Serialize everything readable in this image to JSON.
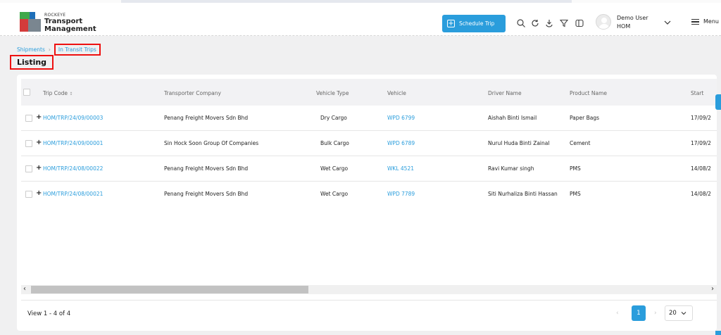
{
  "app": {
    "brand_small": "ROCKEYE",
    "brand_line1": "Transport",
    "brand_line2": "Management"
  },
  "header": {
    "schedule_label": "Schedule Trip",
    "user_name": "Demo User",
    "user_role": "HOM",
    "menu_label": "Menu",
    "icons": [
      "search-icon",
      "refresh-icon",
      "download-icon",
      "filter-icon",
      "layout-icon"
    ]
  },
  "breadcrumb": {
    "root": "Shipments",
    "current": "In Transit Trips"
  },
  "page": {
    "title": "Listing"
  },
  "table": {
    "columns": [
      "Trip Code",
      "Transporter Company",
      "Vehicle Type",
      "Vehicle",
      "Driver Name",
      "Product Name",
      "Start"
    ],
    "sort_indicator": "↕",
    "rows": [
      {
        "trip": "HOM/TRP/24/09/00003",
        "company": "Penang Freight Movers Sdn Bhd",
        "vtype": "Dry Cargo",
        "vehicle": "WPD 6799",
        "driver": "Aishah Binti Ismail",
        "product": "Paper Bags",
        "start": "17/09/2"
      },
      {
        "trip": "HOM/TRP/24/09/00001",
        "company": "Sin Hock Soon Group Of Companies",
        "vtype": "Bulk Cargo",
        "vehicle": "WPD 6789",
        "driver": "Nurul Huda Binti Zainal",
        "product": "Cement",
        "start": "17/09/2"
      },
      {
        "trip": "HOM/TRP/24/08/00022",
        "company": "Penang Freight Movers Sdn Bhd",
        "vtype": "Wet Cargo",
        "vehicle": "WKL 4521",
        "driver": "Ravi Kumar singh",
        "product": "PMS",
        "start": "14/08/2"
      },
      {
        "trip": "HOM/TRP/24/08/00021",
        "company": "Penang Freight Movers Sdn Bhd",
        "vtype": "Wet Cargo",
        "vehicle": "WPD 7789",
        "driver": "Siti Nurhaliza Binti Hassan",
        "product": "PMS",
        "start": "14/08/2"
      }
    ]
  },
  "pagination": {
    "view_text": "View 1 - 4 of 4",
    "current_page": "1",
    "page_size": "20"
  },
  "colors": {
    "accent": "#2a9ddc",
    "highlight": "#ee1111"
  }
}
